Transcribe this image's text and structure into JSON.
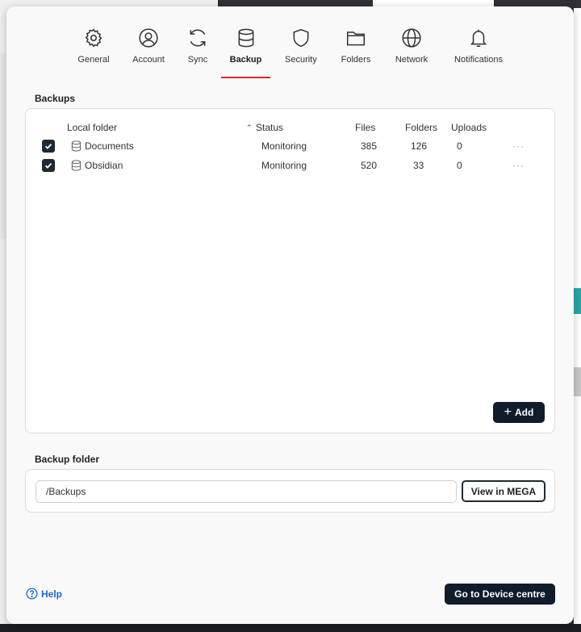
{
  "tabs": [
    {
      "label": "General",
      "icon": "gear-icon"
    },
    {
      "label": "Account",
      "icon": "account-icon"
    },
    {
      "label": "Sync",
      "icon": "sync-icon"
    },
    {
      "label": "Backup",
      "icon": "database-icon",
      "active": true
    },
    {
      "label": "Security",
      "icon": "shield-icon"
    },
    {
      "label": "Folders",
      "icon": "folder-icon"
    },
    {
      "label": "Network",
      "icon": "globe-icon"
    },
    {
      "label": "Notifications",
      "icon": "bell-icon"
    }
  ],
  "backups": {
    "title": "Backups",
    "columns": {
      "local_folder": "Local folder",
      "status": "Status",
      "files": "Files",
      "folders": "Folders",
      "uploads": "Uploads"
    },
    "rows": [
      {
        "name": "Documents",
        "status": "Monitoring",
        "files": "385",
        "folders": "126",
        "uploads": "0",
        "checked": true
      },
      {
        "name": "Obsidian",
        "status": "Monitoring",
        "files": "520",
        "folders": "33",
        "uploads": "0",
        "checked": true
      }
    ],
    "more_label": "···",
    "add_label": "Add"
  },
  "backup_folder": {
    "title": "Backup folder",
    "path": "/Backups",
    "view_label": "View in MEGA"
  },
  "footer": {
    "help_label": "Help",
    "device_centre_label": "Go to Device centre"
  },
  "colors": {
    "accent": "#d9272e",
    "dark_button": "#0f1c2b",
    "link": "#1c6ad1"
  }
}
